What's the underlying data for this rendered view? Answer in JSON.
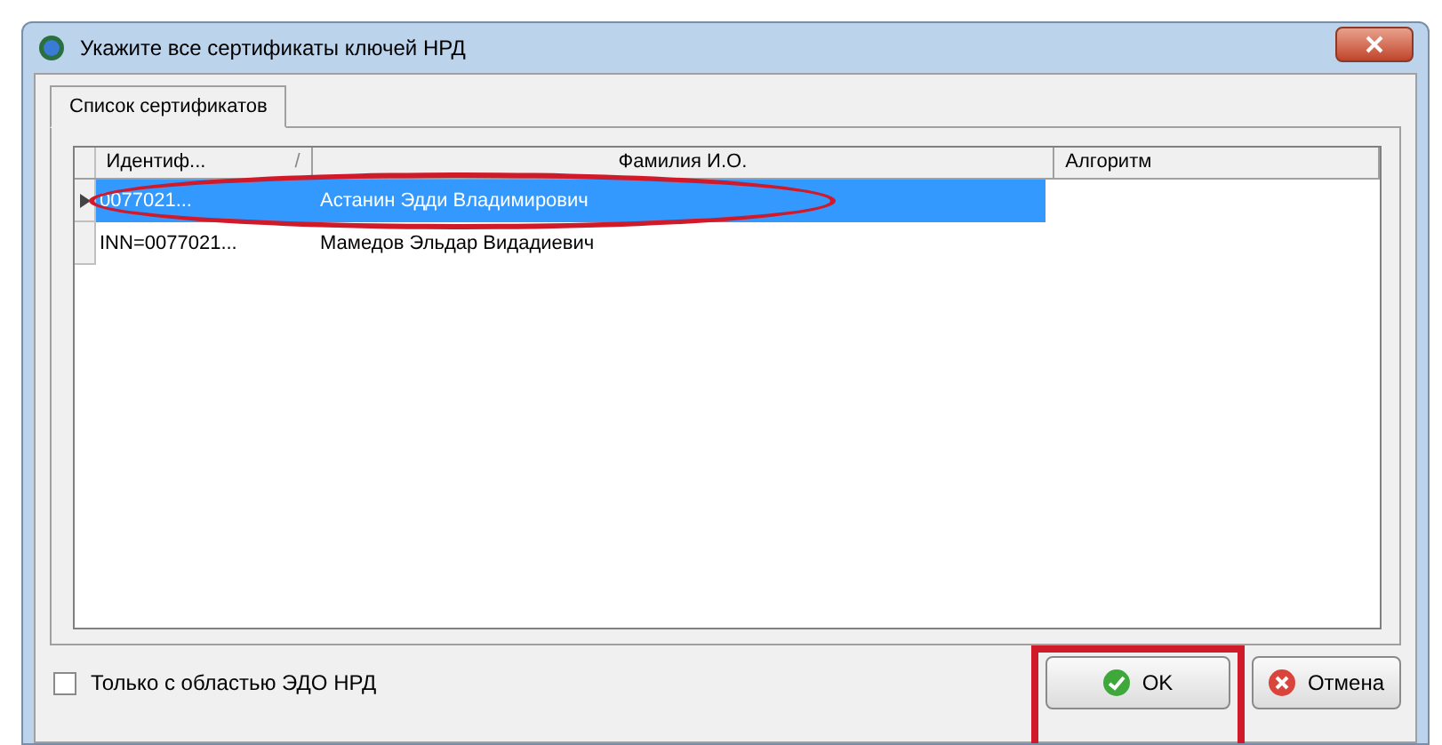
{
  "window": {
    "title": "Укажите все сертификаты ключей НРД"
  },
  "tabs": [
    {
      "label": "Список сертификатов",
      "selected": true
    }
  ],
  "table": {
    "columns": [
      {
        "label": "Идентиф...",
        "sort_mark": "/"
      },
      {
        "label": "Фамилия И.О."
      },
      {
        "label": "Алгоритм"
      }
    ],
    "rows": [
      {
        "cells": [
          "0077021...",
          "Астанин Эдди Владимирович",
          ""
        ],
        "selected": true,
        "circled": true
      },
      {
        "cells": [
          "INN=0077021...",
          "Мамедов Эльдар Видадиевич",
          ""
        ],
        "selected": false,
        "circled": false
      }
    ]
  },
  "filter": {
    "label": "Только с областью ЭДО НРД",
    "checked": false
  },
  "buttons": [
    {
      "label": "OK",
      "kind": "ok",
      "framed": true
    },
    {
      "label": "Отмена",
      "kind": "cancel",
      "framed": false
    }
  ]
}
